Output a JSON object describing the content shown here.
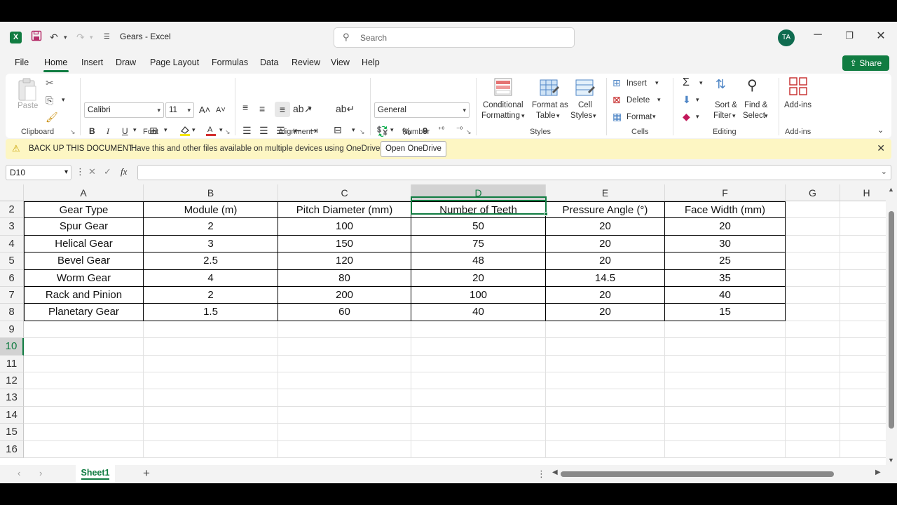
{
  "titlebar": {
    "app_icon": "excel-logo",
    "app_letter": "X",
    "document_title": "Gears  -  Excel",
    "search_placeholder": "Search",
    "avatar_initials": "TA"
  },
  "menu": {
    "items": [
      "File",
      "Home",
      "Insert",
      "Draw",
      "Page Layout",
      "Formulas",
      "Data",
      "Review",
      "View",
      "Help"
    ],
    "active": "Home",
    "share_label": "Share"
  },
  "ribbon": {
    "clipboard": {
      "paste_label": "Paste",
      "group_label": "Clipboard"
    },
    "font": {
      "font_name": "Calibri",
      "font_size": "11",
      "group_label": "Font",
      "bold": "B",
      "italic": "I",
      "underline": "U"
    },
    "alignment": {
      "group_label": "Alignment"
    },
    "number": {
      "format": "General",
      "group_label": "Number",
      "percent": "%",
      "comma": "9"
    },
    "styles": {
      "conditional_1": "Conditional",
      "conditional_2": "Formatting",
      "format_table_1": "Format as",
      "format_table_2": "Table",
      "cell_styles_1": "Cell",
      "cell_styles_2": "Styles",
      "group_label": "Styles"
    },
    "cells": {
      "insert": "Insert",
      "delete": "Delete",
      "format": "Format",
      "group_label": "Cells"
    },
    "editing": {
      "sort_1": "Sort &",
      "sort_2": "Filter",
      "find_1": "Find &",
      "find_2": "Select",
      "group_label": "Editing"
    },
    "addins": {
      "label": "Add-ins",
      "group_label": "Add-ins"
    }
  },
  "notification": {
    "title": "BACK UP THIS DOCUMENT",
    "message": "Have this and other files available on multiple devices using OneDrive.",
    "button": "Open OneDrive"
  },
  "formula_bar": {
    "name_box": "D10",
    "fx": "fx",
    "value": ""
  },
  "grid": {
    "columns": [
      "A",
      "B",
      "C",
      "D",
      "E",
      "F",
      "G",
      "H"
    ],
    "selected_column": "D",
    "row_numbers": [
      "2",
      "3",
      "4",
      "5",
      "6",
      "7",
      "8",
      "9",
      "10",
      "11",
      "12",
      "13",
      "14",
      "15",
      "16"
    ],
    "selected_row": "10",
    "table": [
      [
        "Gear Type",
        "Module (m)",
        "Pitch Diameter (mm)",
        "Number of Teeth",
        "Pressure Angle (°)",
        "Face Width (mm)"
      ],
      [
        "Spur Gear",
        "2",
        "100",
        "50",
        "20",
        "20"
      ],
      [
        "Helical Gear",
        "3",
        "150",
        "75",
        "20",
        "30"
      ],
      [
        "Bevel Gear",
        "2.5",
        "120",
        "48",
        "20",
        "25"
      ],
      [
        "Worm Gear",
        "4",
        "80",
        "20",
        "14.5",
        "35"
      ],
      [
        "Rack and Pinion",
        "2",
        "200",
        "100",
        "20",
        "40"
      ],
      [
        "Planetary Gear",
        "1.5",
        "60",
        "40",
        "20",
        "15"
      ]
    ]
  },
  "sheets": {
    "tabs": [
      "Sheet1"
    ],
    "active": "Sheet1"
  },
  "colors": {
    "accent": "#107c41",
    "notification_bg": "#fdf6c3"
  }
}
